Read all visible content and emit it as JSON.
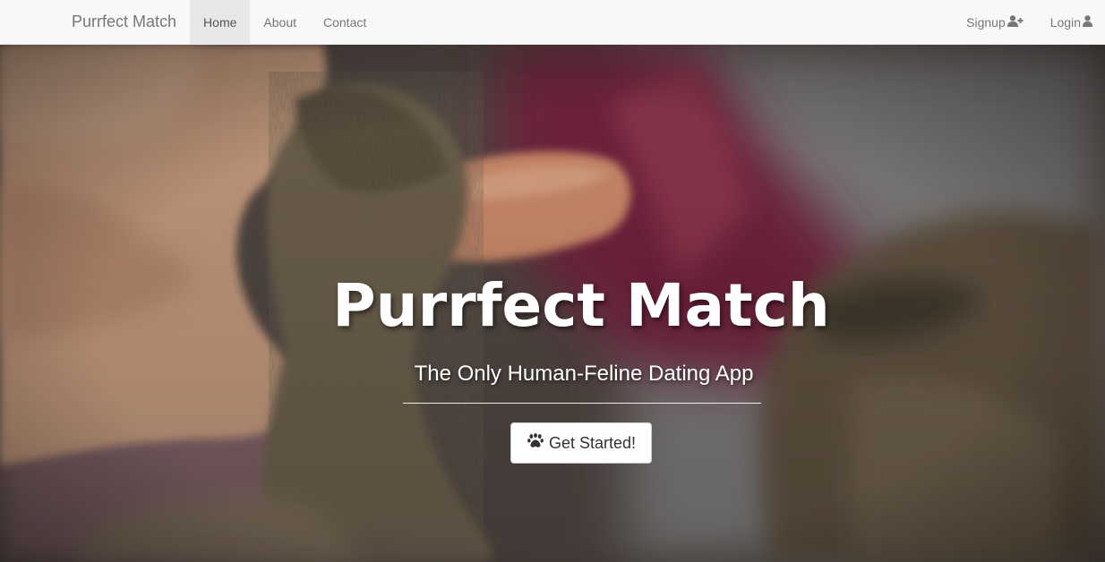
{
  "navbar": {
    "brand": "Purrfect Match",
    "links": [
      {
        "label": "Home",
        "active": true
      },
      {
        "label": "About",
        "active": false
      },
      {
        "label": "Contact",
        "active": false
      }
    ],
    "right_links": [
      {
        "label": "Signup",
        "icon": "user-plus-icon"
      },
      {
        "label": "Login",
        "icon": "user-icon"
      }
    ]
  },
  "hero": {
    "title": "Purrfect Match",
    "subtitle": "The Only Human-Feline Dating App",
    "cta_label": "Get Started!",
    "cta_icon": "paw-icon",
    "background": "photo of a human hand touching a cat's paw"
  },
  "colors": {
    "navbar_bg": "#f8f8f8",
    "nav_active_bg": "#e7e7e7",
    "nav_text": "#777777",
    "hero_text": "#ffffff",
    "button_bg": "#ffffff",
    "button_text": "#333333"
  }
}
